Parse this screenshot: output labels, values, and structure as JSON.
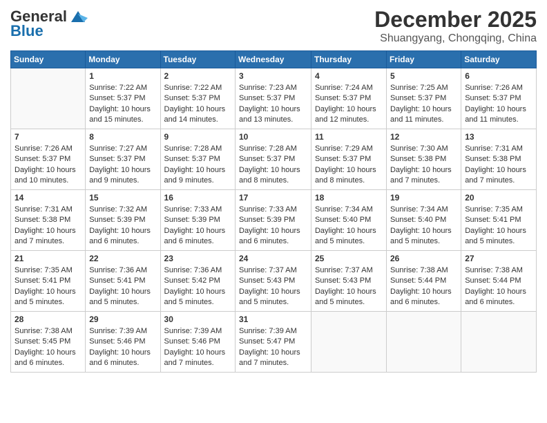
{
  "header": {
    "logo_general": "General",
    "logo_blue": "Blue",
    "month_title": "December 2025",
    "location": "Shuangyang, Chongqing, China"
  },
  "weekdays": [
    "Sunday",
    "Monday",
    "Tuesday",
    "Wednesday",
    "Thursday",
    "Friday",
    "Saturday"
  ],
  "weeks": [
    [
      {
        "day": "",
        "info": ""
      },
      {
        "day": "1",
        "info": "Sunrise: 7:22 AM\nSunset: 5:37 PM\nDaylight: 10 hours\nand 15 minutes."
      },
      {
        "day": "2",
        "info": "Sunrise: 7:22 AM\nSunset: 5:37 PM\nDaylight: 10 hours\nand 14 minutes."
      },
      {
        "day": "3",
        "info": "Sunrise: 7:23 AM\nSunset: 5:37 PM\nDaylight: 10 hours\nand 13 minutes."
      },
      {
        "day": "4",
        "info": "Sunrise: 7:24 AM\nSunset: 5:37 PM\nDaylight: 10 hours\nand 12 minutes."
      },
      {
        "day": "5",
        "info": "Sunrise: 7:25 AM\nSunset: 5:37 PM\nDaylight: 10 hours\nand 11 minutes."
      },
      {
        "day": "6",
        "info": "Sunrise: 7:26 AM\nSunset: 5:37 PM\nDaylight: 10 hours\nand 11 minutes."
      }
    ],
    [
      {
        "day": "7",
        "info": "Sunrise: 7:26 AM\nSunset: 5:37 PM\nDaylight: 10 hours\nand 10 minutes."
      },
      {
        "day": "8",
        "info": "Sunrise: 7:27 AM\nSunset: 5:37 PM\nDaylight: 10 hours\nand 9 minutes."
      },
      {
        "day": "9",
        "info": "Sunrise: 7:28 AM\nSunset: 5:37 PM\nDaylight: 10 hours\nand 9 minutes."
      },
      {
        "day": "10",
        "info": "Sunrise: 7:28 AM\nSunset: 5:37 PM\nDaylight: 10 hours\nand 8 minutes."
      },
      {
        "day": "11",
        "info": "Sunrise: 7:29 AM\nSunset: 5:37 PM\nDaylight: 10 hours\nand 8 minutes."
      },
      {
        "day": "12",
        "info": "Sunrise: 7:30 AM\nSunset: 5:38 PM\nDaylight: 10 hours\nand 7 minutes."
      },
      {
        "day": "13",
        "info": "Sunrise: 7:31 AM\nSunset: 5:38 PM\nDaylight: 10 hours\nand 7 minutes."
      }
    ],
    [
      {
        "day": "14",
        "info": "Sunrise: 7:31 AM\nSunset: 5:38 PM\nDaylight: 10 hours\nand 7 minutes."
      },
      {
        "day": "15",
        "info": "Sunrise: 7:32 AM\nSunset: 5:39 PM\nDaylight: 10 hours\nand 6 minutes."
      },
      {
        "day": "16",
        "info": "Sunrise: 7:33 AM\nSunset: 5:39 PM\nDaylight: 10 hours\nand 6 minutes."
      },
      {
        "day": "17",
        "info": "Sunrise: 7:33 AM\nSunset: 5:39 PM\nDaylight: 10 hours\nand 6 minutes."
      },
      {
        "day": "18",
        "info": "Sunrise: 7:34 AM\nSunset: 5:40 PM\nDaylight: 10 hours\nand 5 minutes."
      },
      {
        "day": "19",
        "info": "Sunrise: 7:34 AM\nSunset: 5:40 PM\nDaylight: 10 hours\nand 5 minutes."
      },
      {
        "day": "20",
        "info": "Sunrise: 7:35 AM\nSunset: 5:41 PM\nDaylight: 10 hours\nand 5 minutes."
      }
    ],
    [
      {
        "day": "21",
        "info": "Sunrise: 7:35 AM\nSunset: 5:41 PM\nDaylight: 10 hours\nand 5 minutes."
      },
      {
        "day": "22",
        "info": "Sunrise: 7:36 AM\nSunset: 5:41 PM\nDaylight: 10 hours\nand 5 minutes."
      },
      {
        "day": "23",
        "info": "Sunrise: 7:36 AM\nSunset: 5:42 PM\nDaylight: 10 hours\nand 5 minutes."
      },
      {
        "day": "24",
        "info": "Sunrise: 7:37 AM\nSunset: 5:43 PM\nDaylight: 10 hours\nand 5 minutes."
      },
      {
        "day": "25",
        "info": "Sunrise: 7:37 AM\nSunset: 5:43 PM\nDaylight: 10 hours\nand 5 minutes."
      },
      {
        "day": "26",
        "info": "Sunrise: 7:38 AM\nSunset: 5:44 PM\nDaylight: 10 hours\nand 6 minutes."
      },
      {
        "day": "27",
        "info": "Sunrise: 7:38 AM\nSunset: 5:44 PM\nDaylight: 10 hours\nand 6 minutes."
      }
    ],
    [
      {
        "day": "28",
        "info": "Sunrise: 7:38 AM\nSunset: 5:45 PM\nDaylight: 10 hours\nand 6 minutes."
      },
      {
        "day": "29",
        "info": "Sunrise: 7:39 AM\nSunset: 5:46 PM\nDaylight: 10 hours\nand 6 minutes."
      },
      {
        "day": "30",
        "info": "Sunrise: 7:39 AM\nSunset: 5:46 PM\nDaylight: 10 hours\nand 7 minutes."
      },
      {
        "day": "31",
        "info": "Sunrise: 7:39 AM\nSunset: 5:47 PM\nDaylight: 10 hours\nand 7 minutes."
      },
      {
        "day": "",
        "info": ""
      },
      {
        "day": "",
        "info": ""
      },
      {
        "day": "",
        "info": ""
      }
    ]
  ]
}
